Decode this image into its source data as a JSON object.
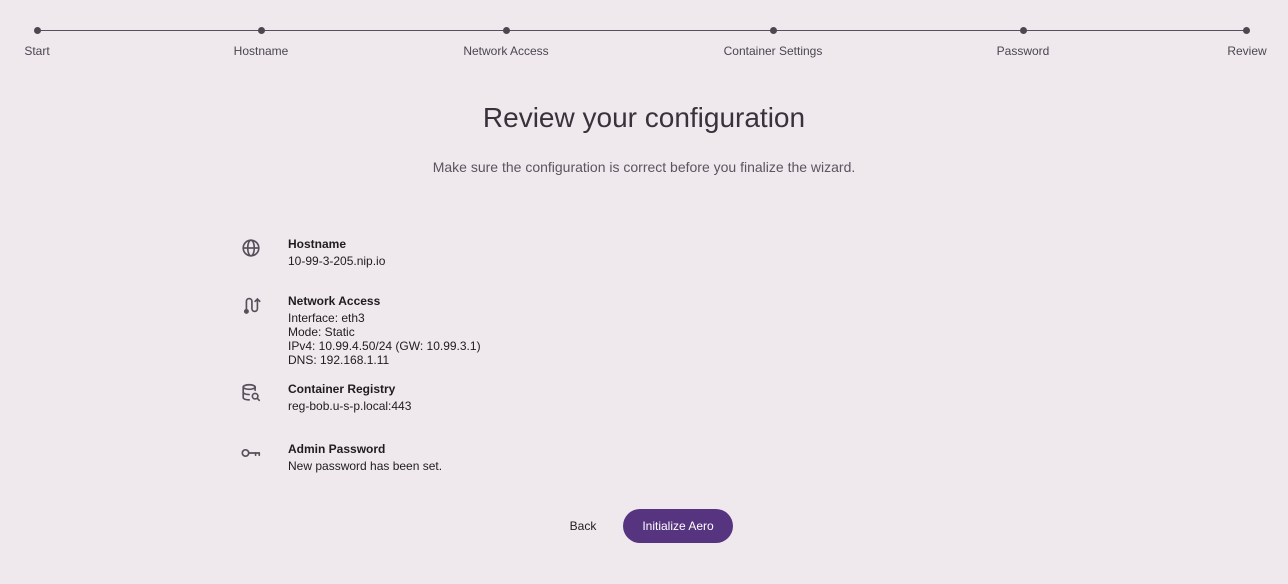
{
  "stepper": {
    "steps": [
      {
        "label": "Start"
      },
      {
        "label": "Hostname"
      },
      {
        "label": "Network Access"
      },
      {
        "label": "Container Settings"
      },
      {
        "label": "Password"
      },
      {
        "label": "Review"
      }
    ]
  },
  "page": {
    "title": "Review your configuration",
    "subtitle": "Make sure the configuration is correct before you finalize the wizard."
  },
  "sections": {
    "hostname": {
      "icon": "globe-icon",
      "heading": "Hostname",
      "lines": [
        "10-99-3-205.nip.io"
      ]
    },
    "network": {
      "icon": "route-icon",
      "heading": "Network Access",
      "lines": [
        "Interface: eth3",
        "Mode: Static",
        "IPv4: 10.99.4.50/24 (GW: 10.99.3.1)",
        "DNS: 192.168.1.11"
      ]
    },
    "registry": {
      "icon": "database-search-icon",
      "heading": "Container Registry",
      "lines": [
        "reg-bob.u-s-p.local:443"
      ]
    },
    "password": {
      "icon": "key-icon",
      "heading": "Admin Password",
      "lines": [
        "New password has been set."
      ]
    }
  },
  "actions": {
    "back_label": "Back",
    "primary_label": "Initialize Aero"
  },
  "colors": {
    "background": "#efe9ee",
    "primary": "#56347f"
  }
}
